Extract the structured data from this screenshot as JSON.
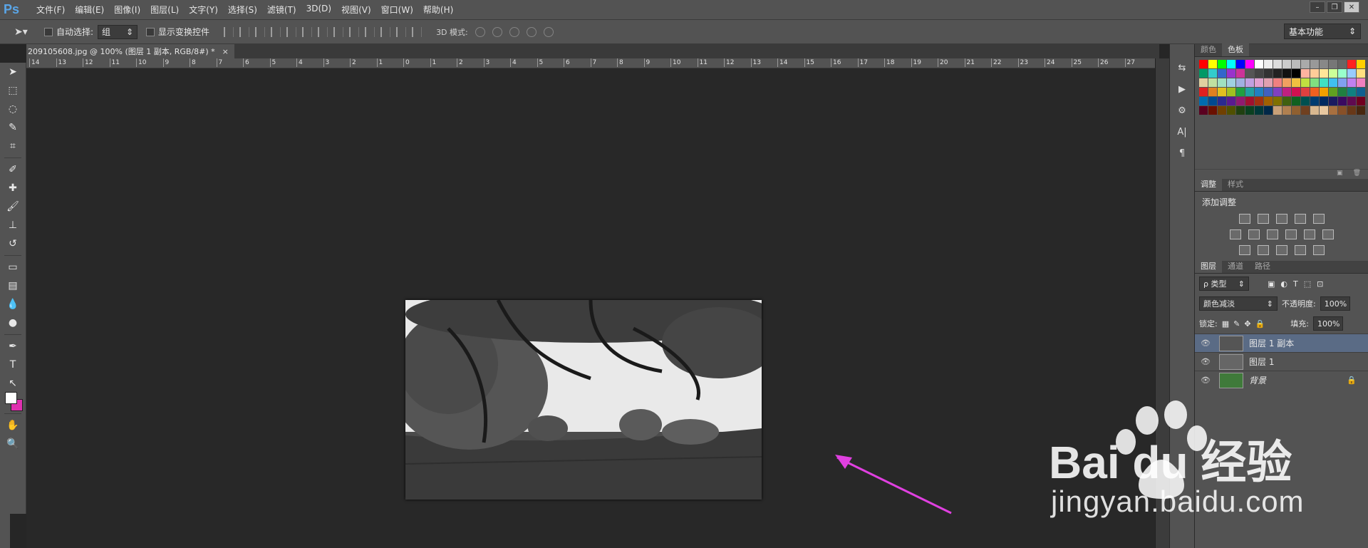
{
  "app": {
    "logo": "Ps"
  },
  "menu": [
    "文件(F)",
    "编辑(E)",
    "图像(I)",
    "图层(L)",
    "文字(Y)",
    "选择(S)",
    "滤镜(T)",
    "3D(D)",
    "视图(V)",
    "窗口(W)",
    "帮助(H)"
  ],
  "window_controls": [
    "–",
    "❐",
    "✕"
  ],
  "options": {
    "auto_select_label": "自动选择:",
    "auto_select_value": "组",
    "show_transform_label": "显示变换控件",
    "mode3d_label": "3D 模式:",
    "workspace": "基本功能"
  },
  "document": {
    "tab_title": "209105608.jpg @ 100% (图层 1 副本, RGB/8#) *",
    "tab_close": "×"
  },
  "ruler_labels": [
    "14",
    "13",
    "12",
    "11",
    "10",
    "9",
    "8",
    "7",
    "6",
    "5",
    "4",
    "3",
    "2",
    "1",
    "0",
    "1",
    "2",
    "3",
    "4",
    "5",
    "6",
    "7",
    "8",
    "9",
    "10",
    "11",
    "12",
    "13",
    "14",
    "15",
    "16",
    "17",
    "18",
    "19",
    "20",
    "21",
    "22",
    "23",
    "24",
    "25",
    "26",
    "27"
  ],
  "toolbar_icons": [
    "move-icon",
    "marquee-icon",
    "lasso-icon",
    "quick-select-icon",
    "crop-icon",
    "eyedropper-icon",
    "healing-icon",
    "brush-icon",
    "stamp-icon",
    "history-brush-icon",
    "eraser-icon",
    "gradient-icon",
    "blur-icon",
    "dodge-icon",
    "pen-icon",
    "type-icon",
    "path-select-icon",
    "shape-icon",
    "hand-icon",
    "zoom-icon"
  ],
  "toolbar_glyphs": [
    "➤",
    "⬚",
    "◌",
    "✎",
    "⌗",
    "✐",
    "✚",
    "🖌",
    "⊥",
    "↺",
    "▭",
    "▤",
    "💧",
    "●",
    "✒",
    "T",
    "↖",
    "⬭",
    "✋",
    "🔍"
  ],
  "colors": {
    "foreground": "#ffffff",
    "background": "#e030b0",
    "arrow": "#e040e0",
    "active_layer": "#5a6b85"
  },
  "swatch_panel": {
    "tab_color": "颜色",
    "tab_swatches": "色板"
  },
  "adjust_panel": {
    "tab_adjust": "调整",
    "tab_styles": "样式",
    "title": "添加调整"
  },
  "layers_panel": {
    "tab_layers": "图层",
    "tab_channels": "通道",
    "tab_paths": "路径",
    "filter_type": "ρ 类型",
    "blend_mode": "颜色减淡",
    "opacity_label": "不透明度:",
    "opacity_value": "100%",
    "lock_label": "锁定:",
    "fill_label": "填充:",
    "fill_value": "100%",
    "layers": [
      {
        "name": "图层 1 副本",
        "active": true
      },
      {
        "name": "图层 1",
        "active": false
      },
      {
        "name": "背景",
        "active": false,
        "locked": true
      }
    ]
  },
  "watermark": {
    "brand": "Bai du 经验",
    "url": "jingyan.baidu.com"
  }
}
